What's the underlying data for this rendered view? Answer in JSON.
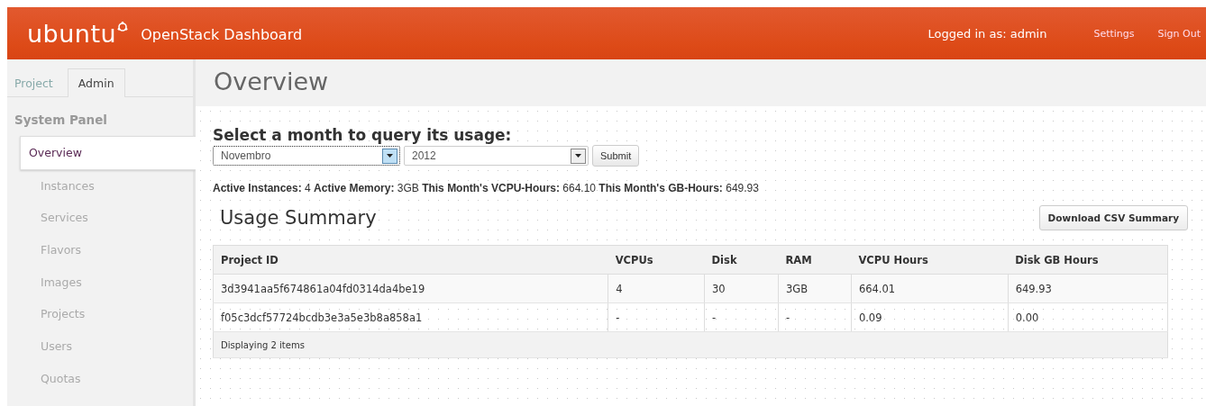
{
  "header": {
    "logo": "ubuntu",
    "title": "OpenStack Dashboard",
    "user": "Logged in as: admin",
    "links": [
      "Settings",
      "Sign Out"
    ]
  },
  "sidebar": {
    "tabs": [
      {
        "label": "Project",
        "selected": false
      },
      {
        "label": "Admin",
        "selected": true
      }
    ],
    "panel_title": "System Panel",
    "items": [
      {
        "label": "Overview",
        "selected": true
      },
      {
        "label": "Instances",
        "selected": false
      },
      {
        "label": "Services",
        "selected": false
      },
      {
        "label": "Flavors",
        "selected": false
      },
      {
        "label": "Images",
        "selected": false
      },
      {
        "label": "Projects",
        "selected": false
      },
      {
        "label": "Users",
        "selected": false
      },
      {
        "label": "Quotas",
        "selected": false
      }
    ]
  },
  "page_title": "Overview",
  "query": {
    "heading": "Select a month to query its usage:",
    "selects": [
      {
        "value": "Novembro",
        "focused": true
      },
      {
        "value": "2012",
        "focused": false
      }
    ],
    "submit": "Submit"
  },
  "stats": "**Active Instances:** 4 **Active Memory:** 3GB **This Month's VCPU-Hours:** 664.10 **This Month's GB-Hours:** 649.93",
  "usage": {
    "title": "Usage Summary",
    "download": "Download CSV Summary",
    "columns": [
      "Project ID",
      "VCPUs",
      "Disk",
      "RAM",
      "VCPU Hours",
      "Disk GB Hours"
    ],
    "rows": [
      [
        "3d3941aa5f674861a04fd0314da4be19",
        "4",
        "30",
        "3GB",
        "664.01",
        "649.93"
      ],
      [
        "f05c3dcf57724bcdb3e3a5e3b8a858a1",
        "-",
        "-",
        "-",
        "0.09",
        "0.00"
      ]
    ],
    "footer": "Displaying 2 items"
  }
}
